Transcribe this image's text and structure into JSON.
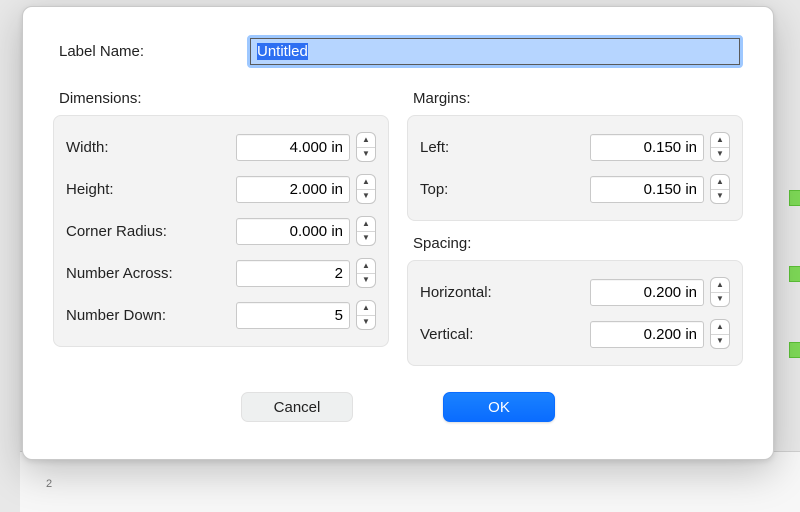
{
  "labelName": {
    "label": "Label Name:",
    "value": "Untitled"
  },
  "dimensions": {
    "heading": "Dimensions:",
    "width": {
      "label": "Width:",
      "value": "4.000 in"
    },
    "height": {
      "label": "Height:",
      "value": "2.000 in"
    },
    "cornerRadius": {
      "label": "Corner Radius:",
      "value": "0.000 in"
    },
    "numAcross": {
      "label": "Number Across:",
      "value": "2"
    },
    "numDown": {
      "label": "Number Down:",
      "value": "5"
    }
  },
  "margins": {
    "heading": "Margins:",
    "left": {
      "label": "Left:",
      "value": "0.150 in"
    },
    "top": {
      "label": "Top:",
      "value": "0.150 in"
    }
  },
  "spacing": {
    "heading": "Spacing:",
    "horizontal": {
      "label": "Horizontal:",
      "value": "0.200 in"
    },
    "vertical": {
      "label": "Vertical:",
      "value": "0.200 in"
    }
  },
  "buttons": {
    "cancel": "Cancel",
    "ok": "OK"
  },
  "ruler": {
    "mark": "2"
  }
}
